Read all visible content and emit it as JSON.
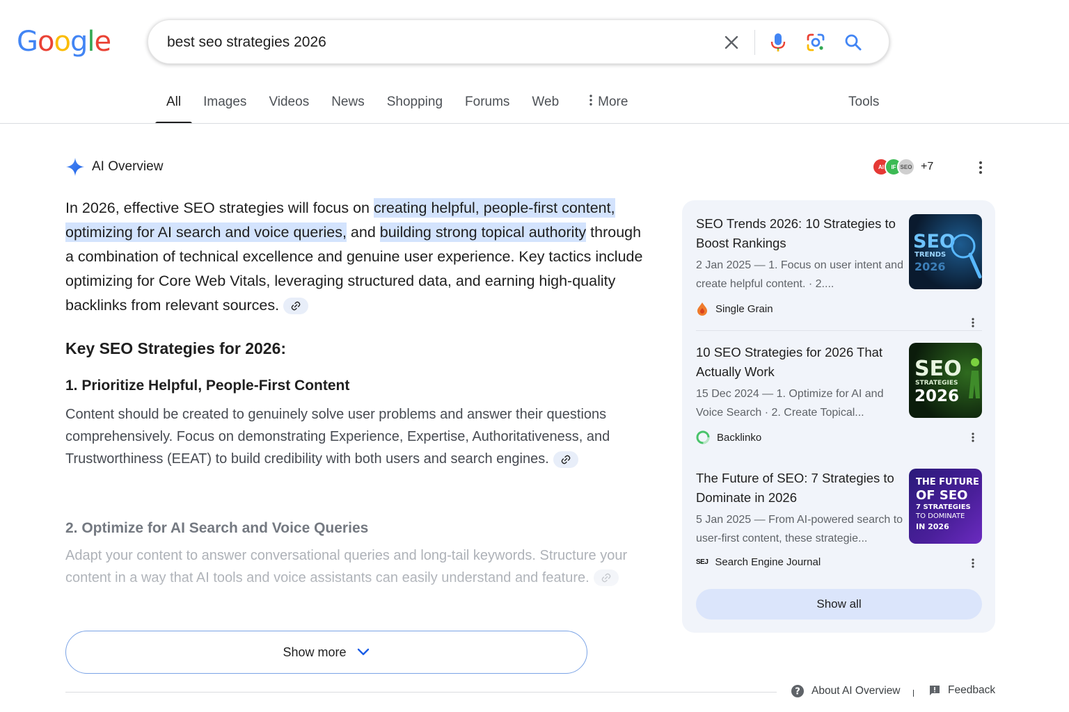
{
  "header": {
    "logo_letters": [
      "G",
      "o",
      "o",
      "g",
      "l",
      "e"
    ],
    "logo_colors": [
      "#4285F4",
      "#EA4335",
      "#FBBC05",
      "#4285F4",
      "#34A853",
      "#EA4335"
    ],
    "search_value": "best seo strategies 2026",
    "icons": [
      "close-icon",
      "mic-icon",
      "lens-icon",
      "search-icon"
    ]
  },
  "tabs": {
    "items": [
      "All",
      "Images",
      "Videos",
      "News",
      "Shopping",
      "Forums",
      "Web",
      "More"
    ],
    "active": "All",
    "tools": "Tools"
  },
  "ai_overview": {
    "title": "AI Overview",
    "sources_count": "+7",
    "intro": {
      "t1": "In 2026, effective SEO strategies will focus on ",
      "h1": "creating helpful, people-first content,",
      "t2": " ",
      "h2": "optimizing for AI search and voice queries,",
      "t3": " and ",
      "h3": "building strong topical authority",
      "t4": " through a combination of technical excellence and genuine user experience. Key tactics include optimizing for Core Web Vitals, leveraging structured data, and earning high-quality backlinks from relevant sources."
    },
    "key_heading": "Key SEO Strategies for 2026:",
    "section1": {
      "heading": "1. Prioritize Helpful, People-First Content",
      "body": "Content should be created to genuinely solve user problems and answer their questions comprehensively. Focus on demonstrating Experience, Expertise, Authoritativeness, and Trustworthiness (EEAT) to build credibility with both users and search engines."
    },
    "section2": {
      "heading": "2. Optimize for AI Search and Voice Queries",
      "body": "Adapt your content to answer conversational queries and long-tail keywords. Structure your content in a way that AI tools and voice assistants can easily understand and feature."
    },
    "show_more": "Show more"
  },
  "sources": {
    "cards": [
      {
        "title": "SEO Trends 2026: 10 Strategies to Boost Rankings",
        "snippet": "2 Jan 2025 — 1. Focus on user intent and create helpful content. · 2....",
        "site": "Single Grain",
        "thumb_lines": [
          "SEO",
          "TRENDS",
          "2026"
        ]
      },
      {
        "title": "10 SEO Strategies for 2026 That Actually Work",
        "snippet": "15 Dec 2024 — 1. Optimize for AI and Voice Search · 2. Create Topical...",
        "site": "Backlinko",
        "thumb_lines": [
          "SEO",
          "STRATEGIES",
          "2026"
        ]
      },
      {
        "title": "The Future of SEO: 7 Strategies to Dominate in 2026",
        "snippet": "5 Jan 2025 — From AI-powered search to user-first content, these strategie...",
        "site": "Search Engine Journal",
        "site_logo": "SEJ",
        "thumb_lines": [
          "THE FUTURE",
          "OF SEO",
          "7 STRATEGIES",
          "TO DOMINATE",
          "IN 2026"
        ]
      }
    ],
    "show_all": "Show all"
  },
  "footer": {
    "about": "About AI Overview",
    "feedback": "Feedback"
  }
}
